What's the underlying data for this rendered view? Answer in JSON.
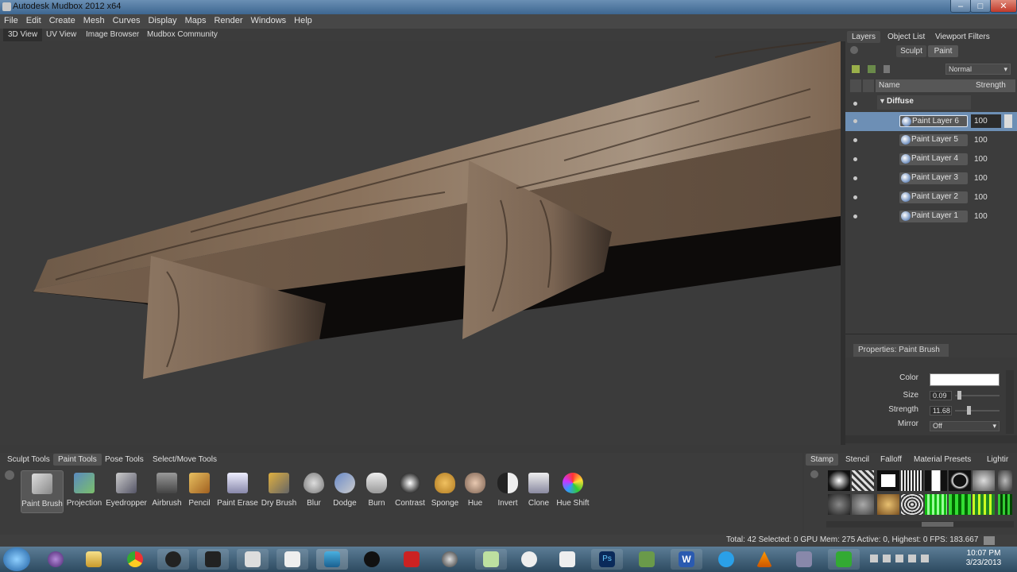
{
  "window": {
    "title": "Autodesk Mudbox 2012 x64"
  },
  "menu": [
    "File",
    "Edit",
    "Create",
    "Mesh",
    "Curves",
    "Display",
    "Maps",
    "Render",
    "Windows",
    "Help"
  ],
  "view_tabs": [
    {
      "label": "3D View",
      "active": true
    },
    {
      "label": "UV View",
      "active": false
    },
    {
      "label": "Image Browser",
      "active": false
    },
    {
      "label": "Mudbox Community",
      "active": false
    }
  ],
  "right_panel": {
    "tabs": [
      "Layers",
      "Object List",
      "Viewport Filters"
    ],
    "sculpt_label": "Sculpt",
    "paint_label": "Paint",
    "blend_mode": "Normal",
    "columns": {
      "name": "Name",
      "strength": "Strength"
    },
    "group": "Diffuse",
    "layers": [
      {
        "name": "Paint Layer 6",
        "strength": "100",
        "selected": true
      },
      {
        "name": "Paint Layer 5",
        "strength": "100",
        "selected": false
      },
      {
        "name": "Paint Layer 4",
        "strength": "100",
        "selected": false
      },
      {
        "name": "Paint Layer 3",
        "strength": "100",
        "selected": false
      },
      {
        "name": "Paint Layer 2",
        "strength": "100",
        "selected": false
      },
      {
        "name": "Paint Layer 1",
        "strength": "100",
        "selected": false
      }
    ]
  },
  "properties": {
    "tab": "Properties: Paint Brush",
    "color_label": "Color",
    "color_value": "#ffffff",
    "size_label": "Size",
    "size_value": "0.09",
    "strength_label": "Strength",
    "strength_value": "11.68",
    "mirror_label": "Mirror",
    "mirror_value": "Off"
  },
  "tool_tabs": [
    {
      "label": "Sculpt Tools",
      "active": false
    },
    {
      "label": "Paint Tools",
      "active": true
    },
    {
      "label": "Pose Tools",
      "active": false
    },
    {
      "label": "Select/Move Tools",
      "active": false
    }
  ],
  "tools": [
    {
      "label": "Paint Brush",
      "icon": "paint-brush-icon",
      "selected": true
    },
    {
      "label": "Projection",
      "icon": "projection-icon",
      "selected": false
    },
    {
      "label": "Eyedropper",
      "icon": "eyedropper-icon",
      "selected": false
    },
    {
      "label": "Airbrush",
      "icon": "airbrush-icon",
      "selected": false
    },
    {
      "label": "Pencil",
      "icon": "pencil-icon",
      "selected": false
    },
    {
      "label": "Paint Erase",
      "icon": "eraser-icon",
      "selected": false
    },
    {
      "label": "Dry Brush",
      "icon": "dry-brush-icon",
      "selected": false
    },
    {
      "label": "Blur",
      "icon": "blur-drop-icon",
      "selected": false
    },
    {
      "label": "Dodge",
      "icon": "dodge-icon",
      "selected": false
    },
    {
      "label": "Burn",
      "icon": "burn-hand-icon",
      "selected": false
    },
    {
      "label": "Contrast",
      "icon": "contrast-sun-icon",
      "selected": false
    },
    {
      "label": "Sponge",
      "icon": "sponge-icon",
      "selected": false
    },
    {
      "label": "Hue",
      "icon": "hue-face-icon",
      "selected": false
    },
    {
      "label": "Invert",
      "icon": "invert-face-icon",
      "selected": false
    },
    {
      "label": "Clone",
      "icon": "clone-stamp-icon",
      "selected": false
    },
    {
      "label": "Hue Shift",
      "icon": "hue-shift-ball-icon",
      "selected": false
    }
  ],
  "stamp_tabs": [
    "Stamp",
    "Stencil",
    "Falloff",
    "Material Presets",
    "Lightir"
  ],
  "status": "Total: 42  Selected: 0 GPU Mem: 275  Active: 0, Highest: 0  FPS: 183.667",
  "clock": {
    "time": "10:07 PM",
    "date": "3/23/2013"
  },
  "taskbar_icons": [
    "windows-start-icon",
    "firefox-icon",
    "explorer-folder-icon",
    "chrome-icon",
    "app-icon",
    "app-icon",
    "app-icon",
    "mudbox-icon",
    "app-icon",
    "steam-icon",
    "app-icon",
    "cinema-icon",
    "unity-icon",
    "app-icon",
    "photoshop-icon",
    "app-icon",
    "word-icon",
    "skype-icon",
    "vlc-icon",
    "app-icon",
    "app-icon"
  ]
}
